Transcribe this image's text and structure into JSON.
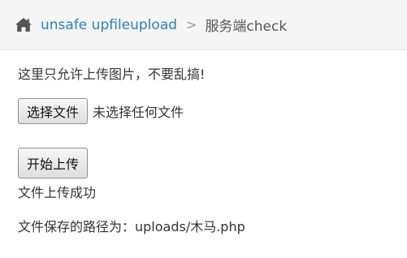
{
  "breadcrumb": {
    "home_icon": "home-icon",
    "link_label": "unsafe upfileupload",
    "separator": ">",
    "current_label": "服务端check"
  },
  "content": {
    "notice_text": "这里只允许上传图片，不要乱搞!",
    "choose_file_label": "选择文件",
    "no_file_text": "未选择任何文件",
    "upload_button_label": "开始上传",
    "success_text": "文件上传成功",
    "path_text": "文件保存的路径为：uploads/木马.php"
  },
  "colors": {
    "link": "#2c7fbd",
    "breadcrumb_bg": "#f5f5f5"
  }
}
